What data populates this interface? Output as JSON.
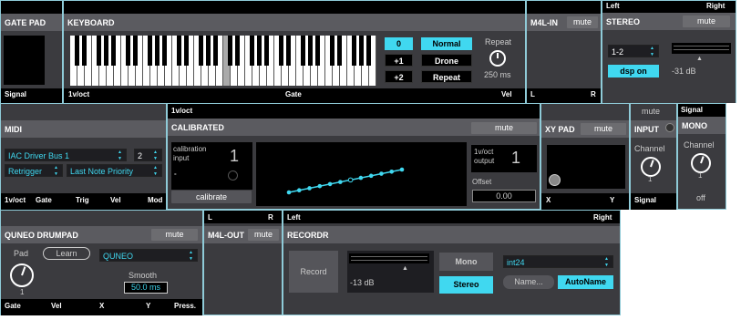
{
  "gatepad": {
    "title": "GATE PAD",
    "out": "Signal"
  },
  "keyboard": {
    "title": "KEYBOARD",
    "octaves": [
      "0",
      "+1",
      "+2"
    ],
    "modes": [
      "Normal",
      "Drone",
      "Repeat"
    ],
    "repeat_label": "Repeat",
    "repeat_value": "250 ms",
    "outs": [
      "1v/oct",
      "Gate",
      "Vel"
    ]
  },
  "m4lin": {
    "title": "M4L-IN",
    "mute": "mute",
    "outs": [
      "L",
      "R"
    ]
  },
  "stereo": {
    "top_left": "Left",
    "top_right": "Right",
    "title": "STEREO",
    "mute": "mute",
    "device": "1-2",
    "dsp": "dsp on",
    "level": "-31 dB"
  },
  "midi": {
    "title": "MIDI",
    "driver": "IAC Driver Bus 1",
    "channel": "2",
    "trigger": "Retrigger",
    "priority": "Last Note Priority",
    "outs": [
      "1v/oct",
      "Gate",
      "Trig",
      "Vel",
      "Mod"
    ]
  },
  "calibrated": {
    "in_label": "1v/oct",
    "title": "CALIBRATED",
    "mute": "mute",
    "cal_input": "calibration\ninput",
    "cal_value": "1",
    "dash": "-",
    "calibrate": "calibrate",
    "out_label": "1v/oct\noutput",
    "out_value": "1",
    "offset_label": "Offset",
    "offset_value": "0.00"
  },
  "xypad": {
    "title": "XY PAD",
    "mute": "mute",
    "outs": [
      "X",
      "Y"
    ]
  },
  "input": {
    "mute": "mute",
    "title": "INPUT",
    "channel_label": "Channel",
    "channel": "1",
    "out": "Signal"
  },
  "mono": {
    "in": "Signal",
    "title": "MONO",
    "channel_label": "Channel",
    "channel": "1",
    "off": "off"
  },
  "quneo": {
    "title": "QUNEO DRUMPAD",
    "mute": "mute",
    "pad_label": "Pad",
    "learn": "Learn",
    "pad_value": "1",
    "device": "QUNEO",
    "smooth_label": "Smooth",
    "smooth_value": "50.0 ms",
    "outs": [
      "Gate",
      "Vel",
      "X",
      "Y",
      "Press."
    ]
  },
  "m4lout": {
    "ins": [
      "L",
      "R"
    ],
    "title": "M4L-OUT",
    "mute": "mute"
  },
  "recordr": {
    "in_left": "Left",
    "in_right": "Right",
    "title": "RECORDR",
    "record": "Record",
    "level": "-13 dB",
    "mono": "Mono",
    "stereo": "Stereo",
    "format": "int24",
    "name": "Name...",
    "autoname": "AutoName"
  },
  "colors": {
    "accent": "#40d8f0",
    "panel": "#3b3b3f",
    "header": "#5b5b60",
    "border": "#8fcbd8"
  }
}
